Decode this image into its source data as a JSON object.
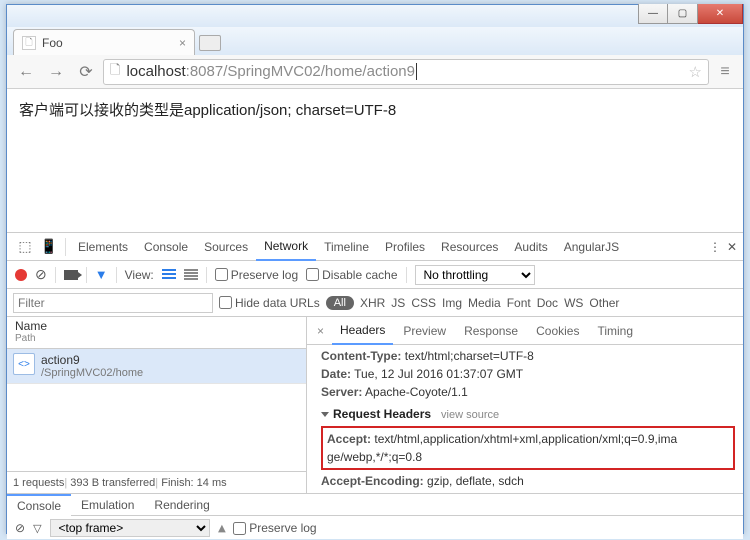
{
  "window": {
    "tab_title": "Foo"
  },
  "toolbar": {
    "url_host": "localhost",
    "url_port": ":8087",
    "url_path": "/SpringMVC02/home/action9"
  },
  "page": {
    "body_text": "客户端可以接收的类型是application/json; charset=UTF-8"
  },
  "devtools": {
    "tabs": [
      "Elements",
      "Console",
      "Sources",
      "Network",
      "Timeline",
      "Profiles",
      "Resources",
      "Audits",
      "AngularJS"
    ],
    "active_tab": "Network",
    "preserve_log": "Preserve log",
    "disable_cache": "Disable cache",
    "view_label": "View:",
    "throttling": "No throttling",
    "filter_placeholder": "Filter",
    "hide_data_urls": "Hide data URLs",
    "type_filters": [
      "All",
      "XHR",
      "JS",
      "CSS",
      "Img",
      "Media",
      "Font",
      "Doc",
      "WS",
      "Other"
    ]
  },
  "reqlist": {
    "header_name": "Name",
    "header_path": "Path",
    "items": [
      {
        "name": "action9",
        "path": "/SpringMVC02/home"
      }
    ],
    "footer": [
      "1 requests",
      "393 B transferred",
      "Finish: 14 ms"
    ]
  },
  "detail": {
    "tabs": [
      "Headers",
      "Preview",
      "Response",
      "Cookies",
      "Timing"
    ],
    "content_type_label": "Content-Type:",
    "content_type_value": "text/html;charset=UTF-8",
    "date_label": "Date:",
    "date_value": "Tue, 12 Jul 2016 01:37:07 GMT",
    "server_label": "Server:",
    "server_value": "Apache-Coyote/1.1",
    "request_headers_label": "Request Headers",
    "view_source": "view source",
    "accept_label": "Accept:",
    "accept_value1": "text/html,application/xhtml+xml,application/xml;q=0.9,ima",
    "accept_value2": "ge/webp,*/*;q=0.8",
    "accept_enc_label": "Accept-Encoding:",
    "accept_enc_value": "gzip, deflate, sdch"
  },
  "drawer": {
    "tabs": [
      "Console",
      "Emulation",
      "Rendering"
    ],
    "frame": "<top frame>",
    "preserve_log": "Preserve log"
  }
}
